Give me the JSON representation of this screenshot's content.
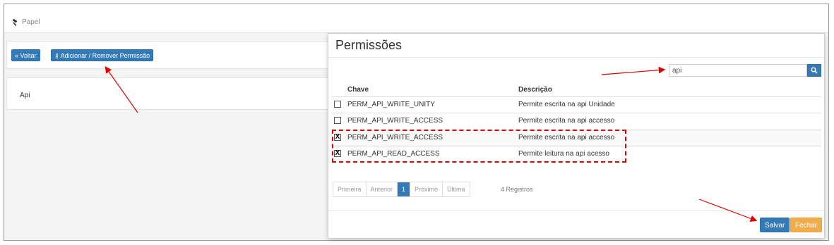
{
  "breadcrumb": {
    "label": "Papel"
  },
  "toolbar": {
    "back_label": "Voltar",
    "add_remove_label": "Adicionar / Remover Permissão"
  },
  "role": {
    "name": "Api"
  },
  "modal": {
    "title": "Permissões",
    "search": {
      "value": "api"
    },
    "columns": {
      "key": "Chave",
      "description": "Descrição"
    },
    "rows": [
      {
        "checked": false,
        "check_mark": "",
        "key": "PERM_API_WRITE_UNITY",
        "description": "Permite escrita na api Unidade"
      },
      {
        "checked": false,
        "check_mark": "",
        "key": "PERM_API_WRITE_ACCESS",
        "description": "Permite escrita na api accesso"
      },
      {
        "checked": true,
        "check_mark": "X",
        "key": "PERM_API_WRITE_ACCESS",
        "description": "Permite escrita na api accesso"
      },
      {
        "checked": true,
        "check_mark": "X",
        "key": "PERM_API_READ_ACCESS",
        "description": "Permite leitura na api acesso"
      }
    ],
    "pagination": {
      "first": "Primeira",
      "previous": "Anterior",
      "current": "1",
      "next": "Próximo",
      "last": "Última",
      "records": "4 Registros"
    },
    "save_label": "Salvar",
    "close_label": "Fechar"
  },
  "colors": {
    "primary": "#337ab7",
    "warning": "#f0ad4e",
    "annotation": "#e00000"
  }
}
